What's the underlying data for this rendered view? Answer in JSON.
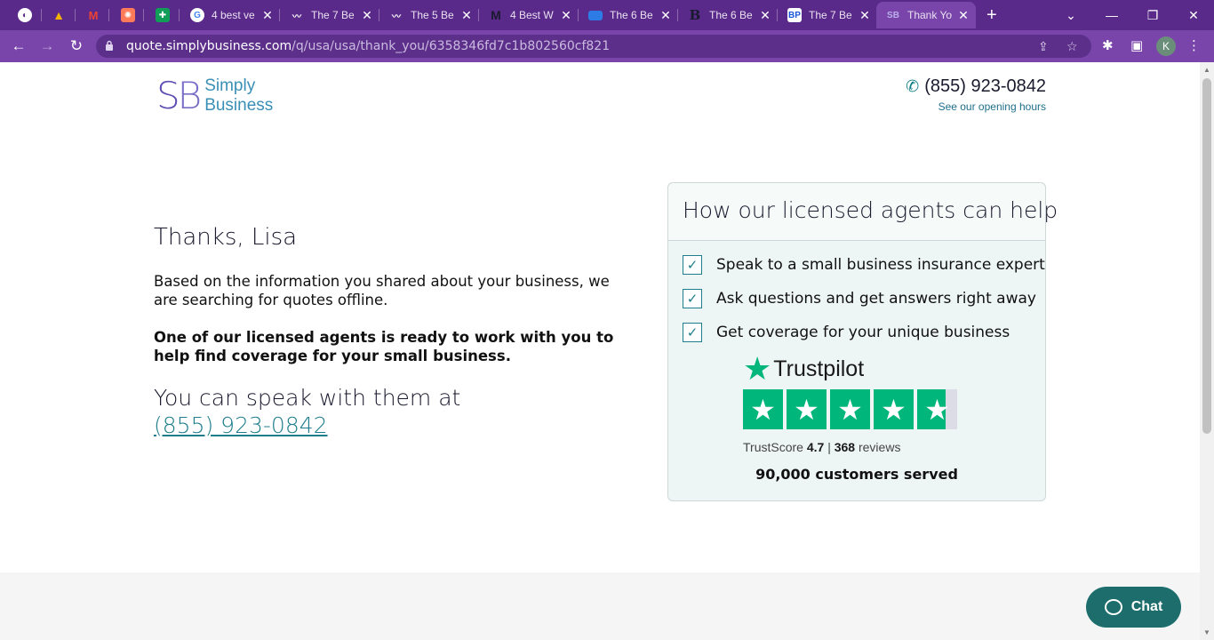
{
  "browser": {
    "tabs": [
      {
        "title": "",
        "icon": "globe-icon",
        "color": "#ffffff"
      },
      {
        "title": "",
        "icon": "drive-icon",
        "color": "#f4b400"
      },
      {
        "title": "",
        "icon": "gmail-icon",
        "color": "#ea4335"
      },
      {
        "title": "",
        "icon": "hubspot-icon",
        "color": "#ff7a59"
      },
      {
        "title": "",
        "icon": "sheets-icon",
        "color": "#0f9d58"
      },
      {
        "title": "4 best ve",
        "icon": "google-icon",
        "color": "#ffffff"
      },
      {
        "title": "The 7 Be",
        "icon": "wave-icon",
        "color": "#ffffff"
      },
      {
        "title": "The 5 Be",
        "icon": "wave-icon",
        "color": "#ffffff"
      },
      {
        "title": "4 Best W",
        "icon": "medium-icon",
        "color": "#1a1a2e"
      },
      {
        "title": "The 6 Be",
        "icon": "card-icon",
        "color": "#2d7be5"
      },
      {
        "title": "The 6 Be",
        "icon": "b-icon",
        "color": "#1a1a2e"
      },
      {
        "title": "The 7 Be",
        "icon": "bp-icon",
        "color": "#1a56db"
      },
      {
        "title": "Thank Yo",
        "icon": "sb-icon",
        "color": "#7a6fc7",
        "active": true
      }
    ],
    "url_host": "quote.simplybusiness.com",
    "url_path": "/q/usa/usa/thank_you/6358346fd7c1b802560cf821",
    "profile_initial": "K"
  },
  "header": {
    "logo_mark_s": "S",
    "logo_mark_b": "B",
    "logo_line1": "Simply",
    "logo_line2": "Business",
    "phone": "(855) 923-0842",
    "hours_link": "See our opening hours"
  },
  "main": {
    "greeting": "Thanks, Lisa",
    "para1": "Based on the information you shared about your business, we are searching for quotes offline.",
    "para2": "One of our licensed agents is ready to work with you to help find coverage for your small business.",
    "speak_text": "You can speak with them at",
    "speak_phone": "(855) 923-0842"
  },
  "card": {
    "title": "How our licensed agents can help",
    "items": [
      "Speak to a small business insurance expert",
      "Ask questions and get answers right away",
      "Get coverage for your unique business"
    ],
    "trustpilot": {
      "brand": "Trustpilot",
      "score_label": "TrustScore",
      "score": "4.7",
      "separator": "|",
      "reviews_count": "368",
      "reviews_label": "reviews",
      "rating_fraction": 0.94
    },
    "served": "90,000 customers served"
  },
  "chat": {
    "label": "Chat"
  },
  "colors": {
    "brand_purple": "#5e4db3",
    "teal": "#1f7e8c",
    "trustpilot_green": "#00b67a",
    "chrome": "#7a45ab"
  }
}
